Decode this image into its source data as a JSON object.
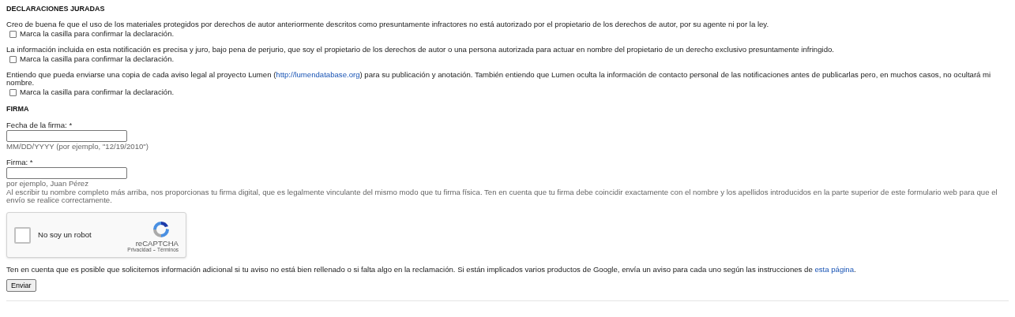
{
  "declarations": {
    "title": "DECLARACIONES JURADAS",
    "statements": [
      {
        "parts": [
          {
            "text": "Creo de buena fe que el uso de los materiales protegidos por derechos de autor anteriormente descritos como presuntamente infractores no está autorizado por el propietario de los derechos de autor, por su agente ni por la ley."
          }
        ],
        "checkbox": {
          "label": "Marca la casilla para confirmar la declaración.",
          "checked": false
        }
      },
      {
        "parts": [
          {
            "text": "La información incluida en esta notificación es precisa y juro, bajo pena de perjurio, que soy el propietario de los derechos de autor o una persona autorizada para actuar en nombre del propietario de un derecho exclusivo presuntamente infringido."
          }
        ],
        "checkbox": {
          "label": "Marca la casilla para confirmar la declaración.",
          "checked": false
        }
      },
      {
        "parts": [
          {
            "text": "Entiendo que pueda enviarse una copia de cada aviso legal al proyecto Lumen ("
          },
          {
            "text": "http://lumendatabase.org",
            "kind": "link"
          },
          {
            "text": ") para su publicación y anotación. También entiendo que Lumen oculta la información de contacto personal de las notificaciones antes de publicarlas pero, en muchos casos, no ocultará mi nombre."
          }
        ],
        "checkbox": {
          "label": "Marca la casilla para confirmar la declaración.",
          "checked": false
        }
      }
    ]
  },
  "signature": {
    "title": "FIRMA",
    "fields": [
      {
        "label": "Fecha de la firma: *",
        "hints": [
          "MM/DD/YYYY (por ejemplo, \"12/19/2010\")"
        ]
      },
      {
        "label": "Firma: *",
        "hints": [
          "por ejemplo, Juan Pérez",
          "Al escribir tu nombre completo más arriba, nos proporcionas tu firma digital, que es legalmente vinculante del mismo modo que tu firma física. Ten en cuenta que tu firma debe coincidir exactamente con el nombre y los apellidos introducidos en la parte superior de este formulario web para que el envío se realice correctamente."
        ]
      }
    ]
  },
  "captcha": {
    "label": "No soy un robot",
    "checked": false,
    "brand": "reCAPTCHA",
    "links": [
      "Privacidad",
      "Términos"
    ],
    "separator": "-"
  },
  "note": {
    "parts": [
      {
        "text": "Ten en cuenta que es posible que solicitemos información adicional si tu aviso no está bien rellenado o si falta algo en la reclamación. Si están implicados varios productos de Google, envía un aviso para cada uno según las instrucciones de "
      },
      {
        "text": "esta página",
        "kind": "link"
      },
      {
        "text": "."
      }
    ]
  },
  "submit": {
    "label": "Enviar"
  }
}
